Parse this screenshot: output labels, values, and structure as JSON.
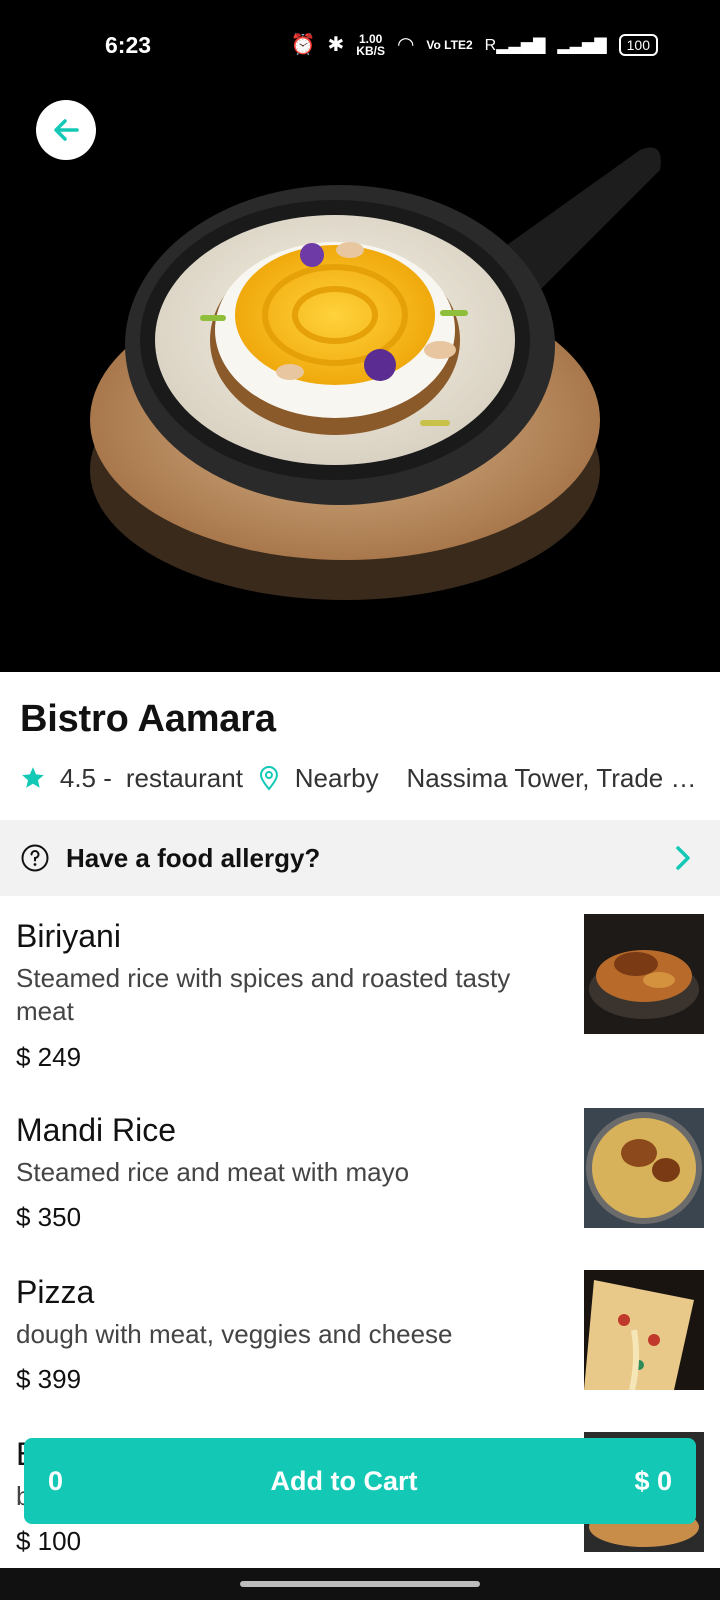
{
  "status_bar": {
    "time": "6:23",
    "speed_top": "1.00",
    "speed_unit": "KB/S",
    "volte": "Vo LTE2",
    "roaming": "R",
    "battery": "100"
  },
  "restaurant": {
    "name": "Bistro Aamara",
    "rating": "4.5 -",
    "type": "restaurant",
    "distance": "Nearby",
    "address": "Nassima Tower, Trade C..."
  },
  "allergy": {
    "label": "Have a food allergy?"
  },
  "menu": [
    {
      "name": "Biriyani",
      "desc": "Steamed rice with spices and roasted tasty meat",
      "price": "$ 249"
    },
    {
      "name": "Mandi Rice",
      "desc": "Steamed rice and meat with mayo",
      "price": "$ 350"
    },
    {
      "name": "Pizza",
      "desc": "dough with meat, veggies and cheese",
      "price": "$ 399"
    },
    {
      "name": "B",
      "desc": "b",
      "price": "$ 100"
    }
  ],
  "cart": {
    "count": "0",
    "label": "Add to Cart",
    "total": "$ 0"
  },
  "colors": {
    "accent": "#13c9b6",
    "hero_bg": "#000000",
    "allergy_bg": "#f2f2f2"
  },
  "icons": [
    "back-arrow-icon",
    "star-icon",
    "location-pin-icon",
    "help-circle-icon",
    "chevron-right-icon"
  ]
}
